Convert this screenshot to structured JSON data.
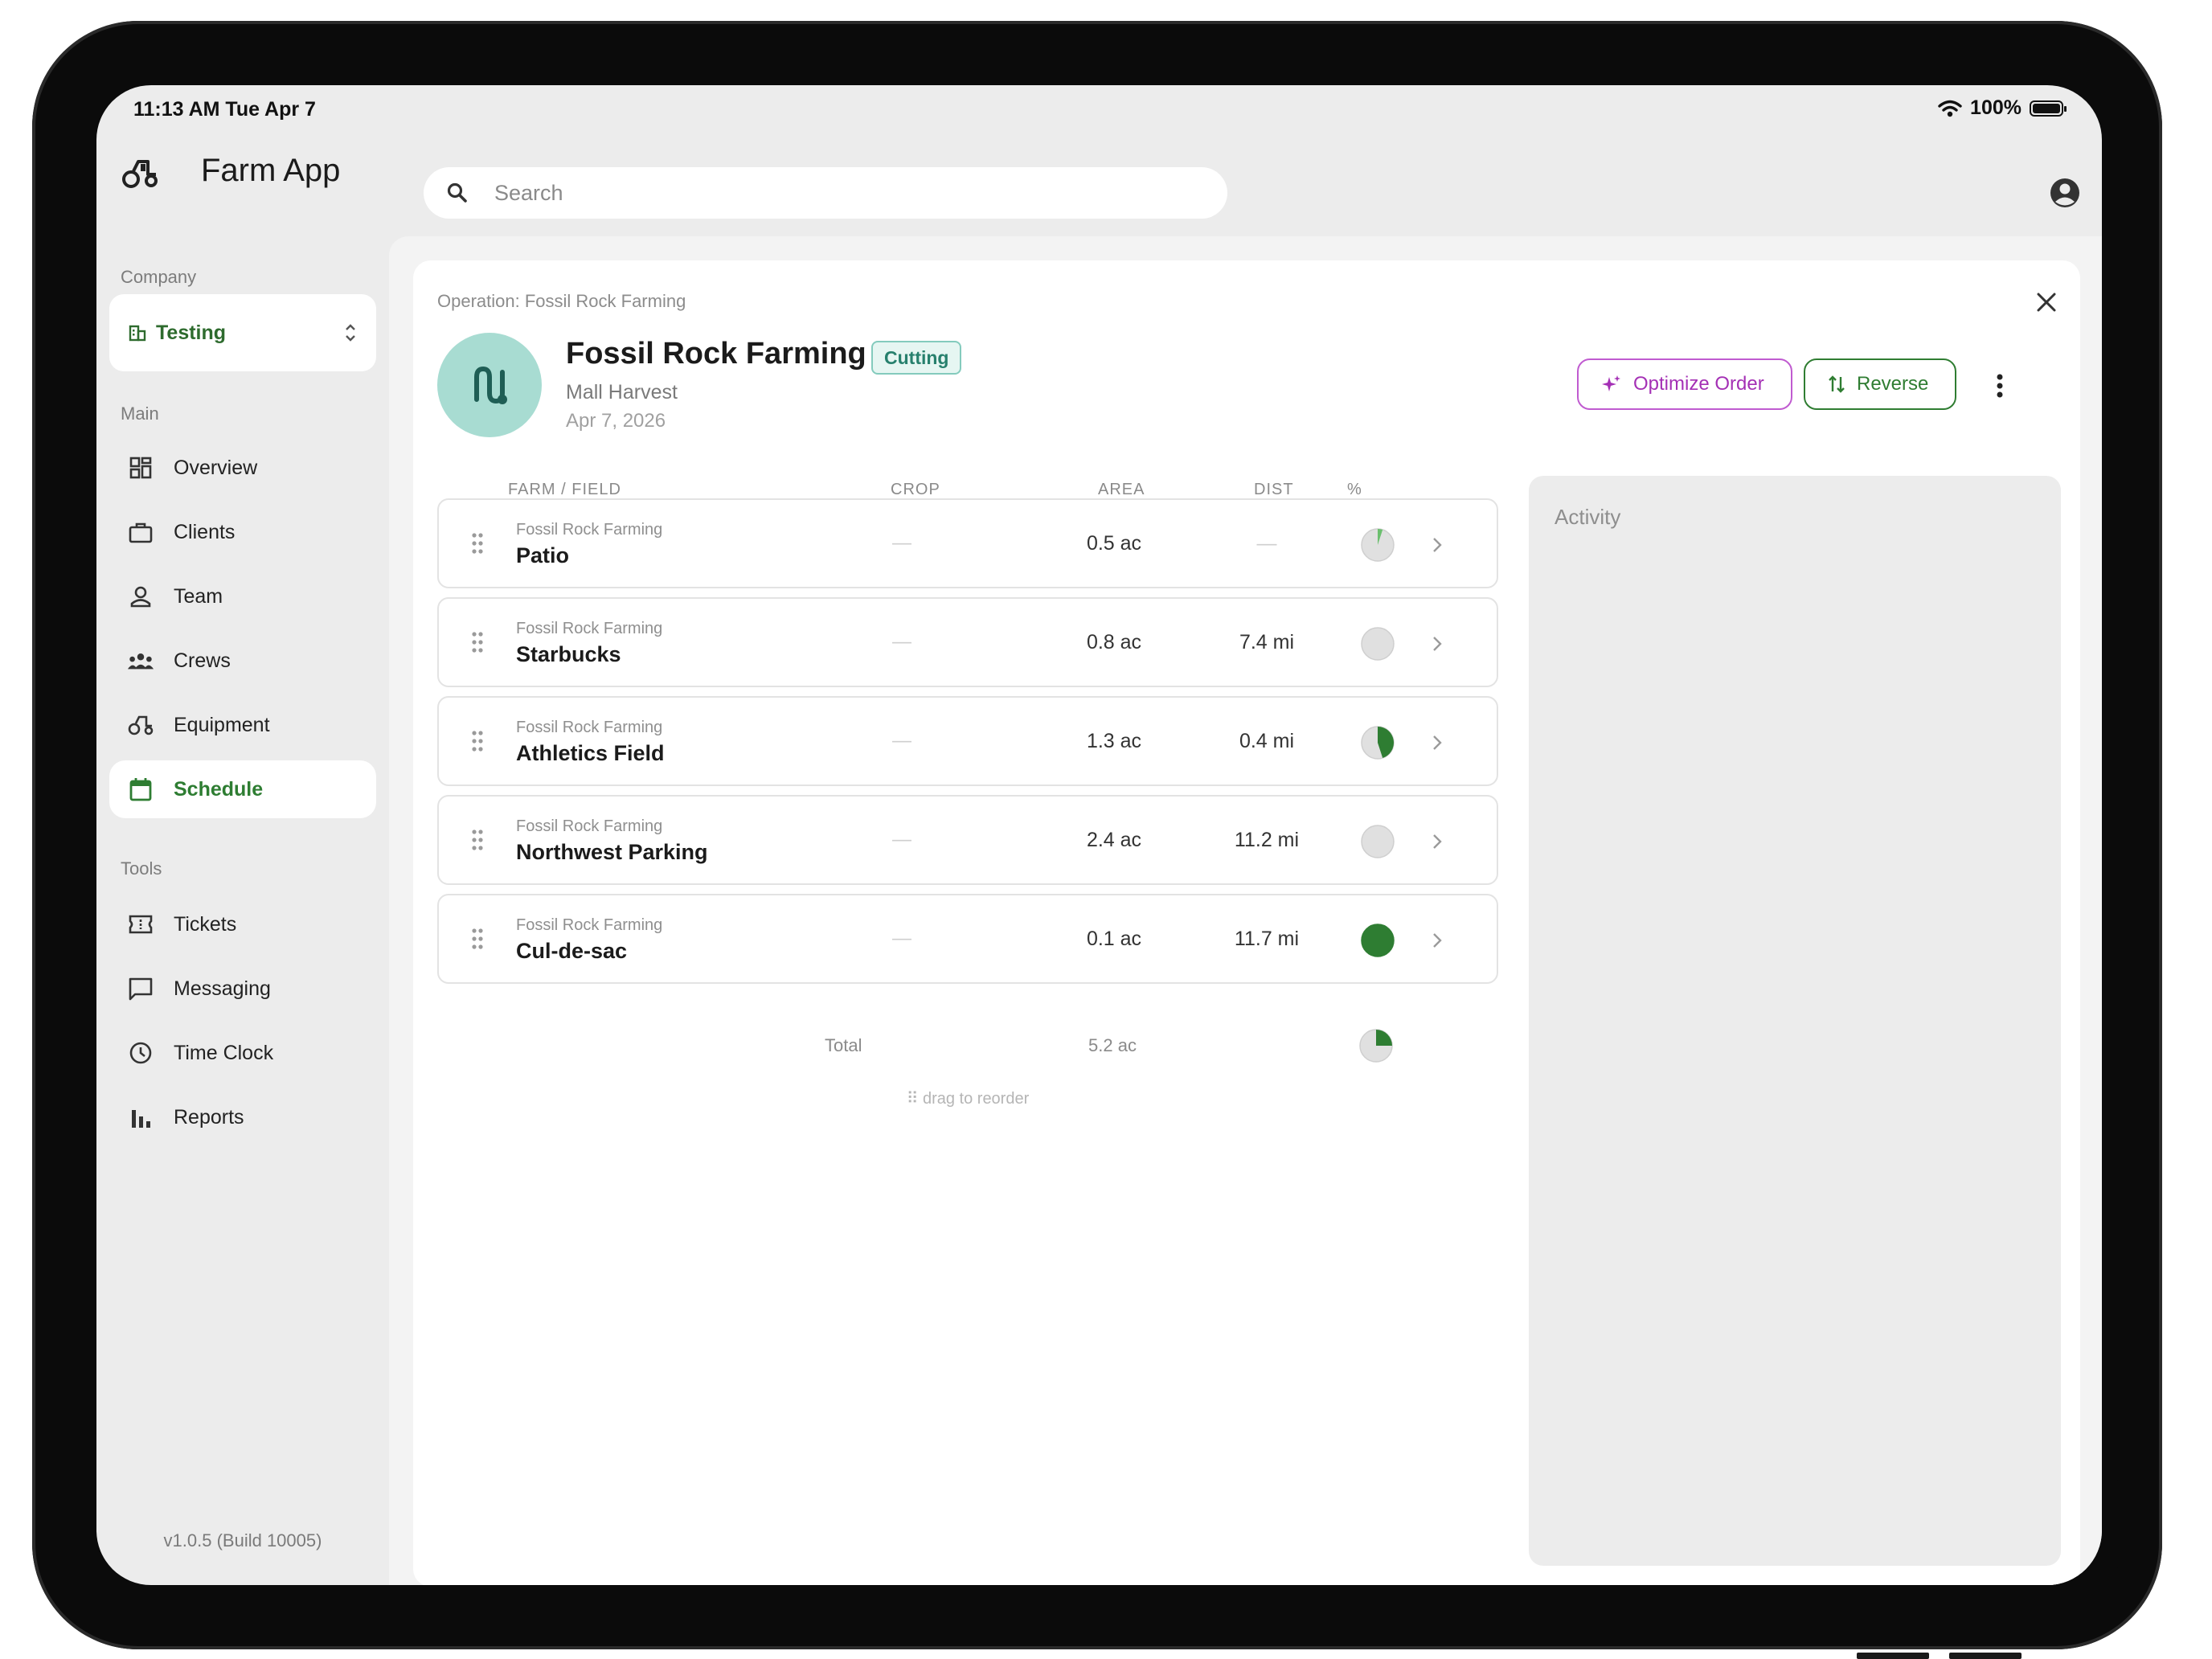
{
  "status_bar": {
    "time": "11:13 AM  Tue Apr 7",
    "battery": "100%"
  },
  "header": {
    "app_title": "Farm App",
    "search_placeholder": "Search"
  },
  "sidebar": {
    "company_label": "Company",
    "company_name": "Testing",
    "main_label": "Main",
    "main_items": [
      {
        "label": "Overview",
        "icon": "grid-icon"
      },
      {
        "label": "Clients",
        "icon": "briefcase-icon"
      },
      {
        "label": "Team",
        "icon": "person-icon"
      },
      {
        "label": "Crews",
        "icon": "group-icon"
      },
      {
        "label": "Equipment",
        "icon": "tractor-icon"
      },
      {
        "label": "Schedule",
        "icon": "calendar-icon",
        "active": true
      }
    ],
    "tools_label": "Tools",
    "tools_items": [
      {
        "label": "Tickets",
        "icon": "ticket-icon"
      },
      {
        "label": "Messaging",
        "icon": "chat-icon"
      },
      {
        "label": "Time Clock",
        "icon": "clock-icon"
      },
      {
        "label": "Reports",
        "icon": "bar-chart-icon"
      }
    ],
    "version": "v1.0.5 (Build 10005)"
  },
  "operation": {
    "breadcrumb": "Operation: Fossil Rock Farming",
    "title": "Fossil Rock Farming",
    "badge": "Cutting",
    "subtitle": "Mall Harvest",
    "date": "Apr 7, 2026",
    "optimize_label": "Optimize Order",
    "reverse_label": "Reverse"
  },
  "table": {
    "headers": {
      "field": "FARM / FIELD",
      "crop": "CROP",
      "area": "AREA",
      "dist": "DIST",
      "pct": "%"
    },
    "rows": [
      {
        "farm": "Fossil Rock Farming",
        "field": "Patio",
        "crop": "—",
        "area": "0.5 ac",
        "dist": "—",
        "progress": 0.05
      },
      {
        "farm": "Fossil Rock Farming",
        "field": "Starbucks",
        "crop": "—",
        "area": "0.8 ac",
        "dist": "7.4 mi",
        "progress": 0
      },
      {
        "farm": "Fossil Rock Farming",
        "field": "Athletics Field",
        "crop": "—",
        "area": "1.3 ac",
        "dist": "0.4 mi",
        "progress": 0.45
      },
      {
        "farm": "Fossil Rock Farming",
        "field": "Northwest Parking",
        "crop": "—",
        "area": "2.4 ac",
        "dist": "11.2 mi",
        "progress": 0
      },
      {
        "farm": "Fossil Rock Farming",
        "field": "Cul-de-sac",
        "crop": "—",
        "area": "0.1 ac",
        "dist": "11.7 mi",
        "progress": 1.0
      }
    ],
    "total_label": "Total",
    "total_area": "5.2 ac",
    "total_progress": 0.25,
    "drag_note": "⠿ drag to reorder"
  },
  "activity": {
    "title": "Activity"
  },
  "colors": {
    "accent_green": "#2e7d32",
    "accent_purple": "#a430b5",
    "badge_teal": "#27806d",
    "avatar_teal": "#a8dcd2"
  }
}
